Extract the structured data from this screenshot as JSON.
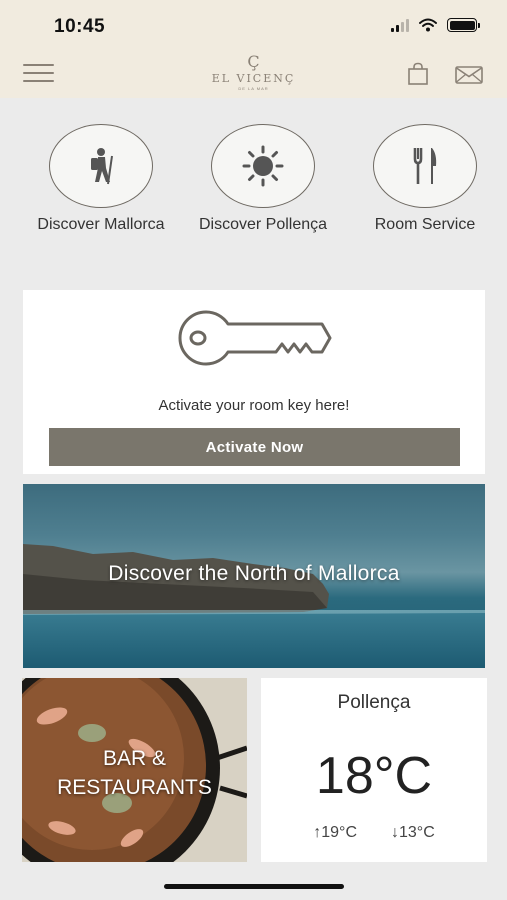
{
  "status_bar": {
    "time": "10:45"
  },
  "header": {
    "logo_mark": "Ç",
    "logo_name": "EL VICENÇ",
    "logo_sub": "DE LA MAR",
    "menu_icon": "hamburger-menu-icon",
    "bag_icon": "shopping-bag-icon",
    "mail_icon": "envelope-icon"
  },
  "quick_actions": [
    {
      "label": "Discover Mallorca",
      "icon": "hiker-icon"
    },
    {
      "label": "Discover Pollença",
      "icon": "sun-icon"
    },
    {
      "label": "Room Service",
      "icon": "fork-knife-icon"
    }
  ],
  "room_key": {
    "icon": "key-icon",
    "prompt": "Activate your room key here!",
    "button_label": "Activate Now"
  },
  "discover_banner": {
    "title": "Discover the North of Mallorca"
  },
  "bar_tile": {
    "line1": "BAR &",
    "line2": "RESTAURANTS"
  },
  "weather": {
    "city": "Pollença",
    "current": "18°C",
    "high": "19°C",
    "low": "13°C"
  },
  "colors": {
    "header_bg": "#f1ebdf",
    "accent": "#8a8176",
    "button_bg": "#7a766c",
    "page_bg": "#ebebeb"
  }
}
